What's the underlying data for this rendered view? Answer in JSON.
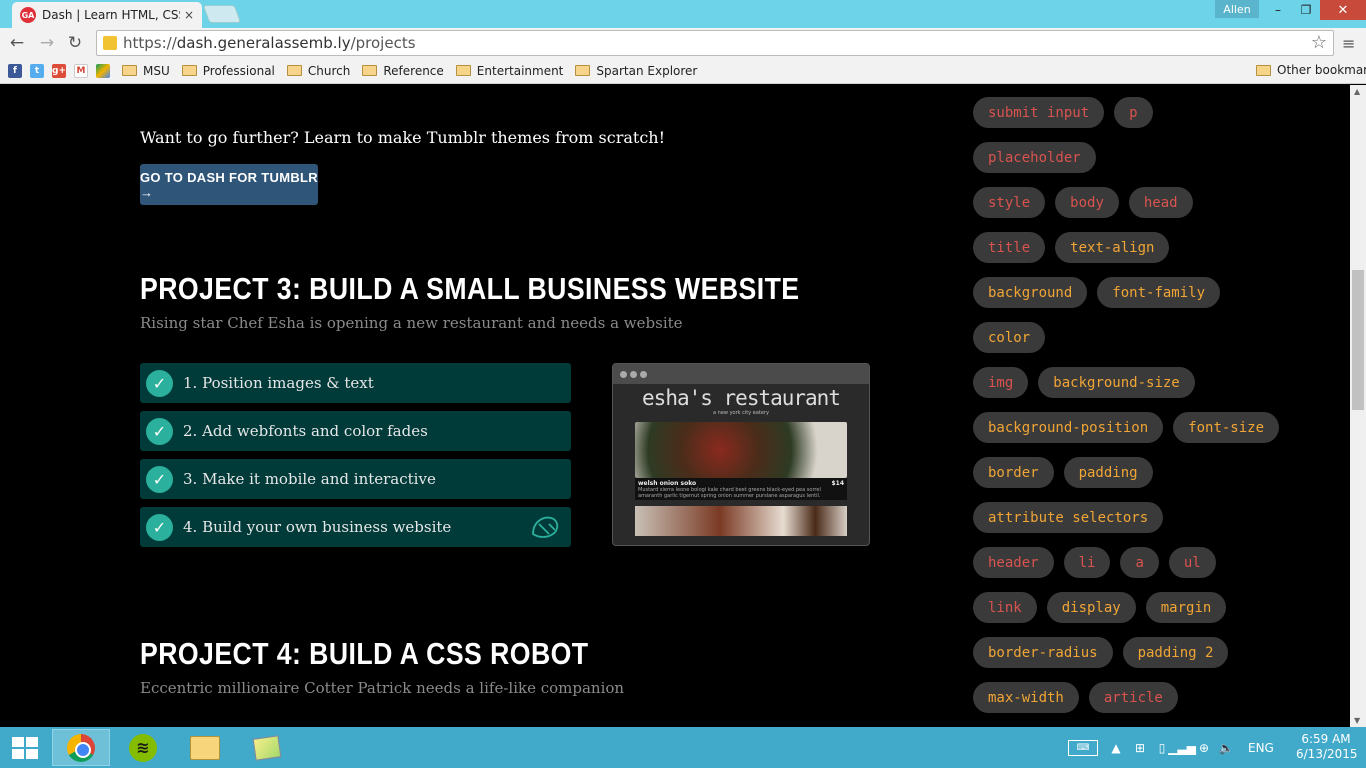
{
  "browser": {
    "tab_title": "Dash | Learn HTML, CSS, J",
    "tab_close": "×",
    "user": "Allen",
    "window_controls": {
      "minimize": "–",
      "maximize": "❐",
      "close": "✕"
    },
    "nav": {
      "back": "←",
      "forward": "→",
      "reload": "↻",
      "menu": "≡"
    },
    "url_scheme": "https://",
    "url_host": "dash.generalassemb.ly",
    "url_path": "/projects",
    "star": "☆"
  },
  "bookmarks": {
    "icons": [
      "facebook",
      "twitter",
      "google-plus",
      "gmail",
      "google-drive"
    ],
    "folders": [
      "MSU",
      "Professional",
      "Church",
      "Reference",
      "Entertainment",
      "Spartan Explorer"
    ],
    "other": "Other bookmarks"
  },
  "page": {
    "further_text": "Want to go further? Learn to make Tumblr themes from scratch!",
    "dash_button": "GO TO DASH FOR TUMBLR →",
    "project3": {
      "title": "PROJECT 3: BUILD A SMALL BUSINESS WEBSITE",
      "subtitle": "Rising star Chef Esha is opening a new restaurant and needs a website",
      "steps": [
        {
          "label": "1. Position images & text",
          "checked": true
        },
        {
          "label": "2. Add webfonts and color fades",
          "checked": true
        },
        {
          "label": "3. Make it mobile and interactive",
          "checked": true
        },
        {
          "label": "4. Build your own business website",
          "checked": true
        }
      ],
      "preview": {
        "title": "esha's restaurant",
        "tagline": "a new york city eatery",
        "dish_name": "welsh onion soko",
        "dish_price": "$14",
        "dish_desc": "Mustard sierra leone bologi kale chard beet greens black-eyed pea sorrel amaranth garlic tigernut spring onion summer purslane asparagus lentil."
      }
    },
    "project4": {
      "title": "PROJECT 4: BUILD A CSS ROBOT",
      "subtitle": "Eccentric millionaire Cotter Patrick needs a life-like companion"
    },
    "tag_colors": {
      "html": "#d9534f",
      "css": "#f0a535",
      "bg": "#3a3a3a"
    },
    "tag_rows": [
      [
        {
          "t": "submit input",
          "k": "html"
        },
        {
          "t": "p",
          "k": "html"
        }
      ],
      [
        {
          "t": "placeholder",
          "k": "html"
        }
      ],
      [
        {
          "t": "style",
          "k": "html"
        },
        {
          "t": "body",
          "k": "html"
        },
        {
          "t": "head",
          "k": "html"
        }
      ],
      [
        {
          "t": "title",
          "k": "html"
        },
        {
          "t": "text-align",
          "k": "css"
        }
      ],
      [
        {
          "t": "background",
          "k": "css"
        },
        {
          "t": "font-family",
          "k": "css"
        }
      ],
      [
        {
          "t": "color",
          "k": "css"
        }
      ],
      [
        {
          "t": "img",
          "k": "html"
        },
        {
          "t": "background-size",
          "k": "css"
        }
      ],
      [
        {
          "t": "background-position",
          "k": "css"
        },
        {
          "t": "font-size",
          "k": "css"
        }
      ],
      [
        {
          "t": "border",
          "k": "css"
        },
        {
          "t": "padding",
          "k": "css"
        }
      ],
      [
        {
          "t": "attribute selectors",
          "k": "css"
        }
      ],
      [
        {
          "t": "header",
          "k": "html"
        },
        {
          "t": "li",
          "k": "html"
        },
        {
          "t": "a",
          "k": "html"
        },
        {
          "t": "ul",
          "k": "html"
        }
      ],
      [
        {
          "t": "link",
          "k": "html"
        },
        {
          "t": "display",
          "k": "css"
        },
        {
          "t": "margin",
          "k": "css"
        }
      ],
      [
        {
          "t": "border-radius",
          "k": "css"
        },
        {
          "t": "padding 2",
          "k": "css"
        }
      ],
      [
        {
          "t": "max-width",
          "k": "css"
        },
        {
          "t": "article",
          "k": "html"
        }
      ]
    ]
  },
  "taskbar": {
    "apps": [
      "chrome",
      "spotify",
      "file-explorer",
      "sticky-notes"
    ],
    "language": "ENG",
    "time": "6:59 AM",
    "date": "6/13/2015"
  }
}
